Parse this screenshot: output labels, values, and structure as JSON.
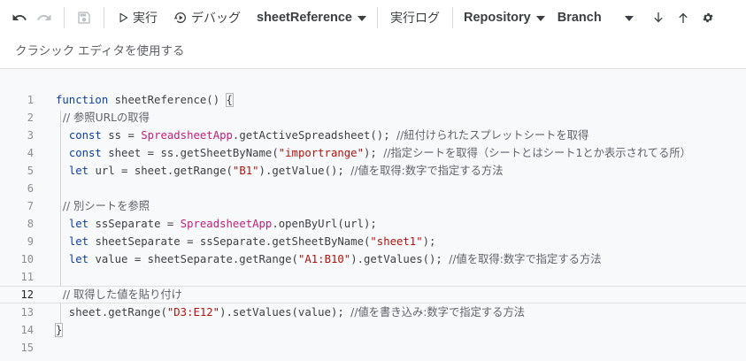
{
  "toolbar": {
    "run_label": "実行",
    "debug_label": "デバッグ",
    "function_select": "sheetReference",
    "log_label": "実行ログ",
    "repository_select": "Repository",
    "branch_select": "Branch"
  },
  "hint": "クラシック エディタを使用する",
  "editor": {
    "active_line": 12,
    "line_numbers": [
      "1",
      "2",
      "3",
      "4",
      "5",
      "6",
      "7",
      "8",
      "9",
      "10",
      "11",
      "12",
      "13",
      "14",
      "15"
    ],
    "lines": [
      [
        {
          "t": "function ",
          "c": "kw"
        },
        {
          "t": "sheetReference() ",
          "c": ""
        },
        {
          "t": "{",
          "c": "brace"
        }
      ],
      [
        {
          "t": "  // 参照URLの取得",
          "c": "cmt"
        }
      ],
      [
        {
          "t": "  ",
          "c": ""
        },
        {
          "t": "const ",
          "c": "kw"
        },
        {
          "t": "ss = ",
          "c": ""
        },
        {
          "t": "SpreadsheetApp",
          "c": "cls"
        },
        {
          "t": ".getActiveSpreadsheet(); ",
          "c": ""
        },
        {
          "t": "//紐付けられたスプレットシートを取得",
          "c": "cmt"
        }
      ],
      [
        {
          "t": "  ",
          "c": ""
        },
        {
          "t": "const ",
          "c": "kw"
        },
        {
          "t": "sheet = ss.getSheetByName(",
          "c": ""
        },
        {
          "t": "\"importrange\"",
          "c": "str"
        },
        {
          "t": "); ",
          "c": ""
        },
        {
          "t": "//指定シートを取得（シートとはシート1とか表示されてる所）",
          "c": "cmt"
        }
      ],
      [
        {
          "t": "  ",
          "c": ""
        },
        {
          "t": "let ",
          "c": "kw"
        },
        {
          "t": "url = sheet.getRange(",
          "c": ""
        },
        {
          "t": "\"B1\"",
          "c": "str"
        },
        {
          "t": ").getValue(); ",
          "c": ""
        },
        {
          "t": "//値を取得:数字で指定する方法",
          "c": "cmt"
        }
      ],
      [],
      [
        {
          "t": "  // 別シートを参照",
          "c": "cmt"
        }
      ],
      [
        {
          "t": "  ",
          "c": ""
        },
        {
          "t": "let ",
          "c": "kw"
        },
        {
          "t": "ssSeparate = ",
          "c": ""
        },
        {
          "t": "SpreadsheetApp",
          "c": "cls"
        },
        {
          "t": ".openByUrl(url);",
          "c": ""
        }
      ],
      [
        {
          "t": "  ",
          "c": ""
        },
        {
          "t": "let ",
          "c": "kw"
        },
        {
          "t": "sheetSeparate = ssSeparate.getSheetByName(",
          "c": ""
        },
        {
          "t": "\"sheet1\"",
          "c": "str"
        },
        {
          "t": ");",
          "c": ""
        }
      ],
      [
        {
          "t": "  ",
          "c": ""
        },
        {
          "t": "let ",
          "c": "kw"
        },
        {
          "t": "value = sheetSeparate.getRange(",
          "c": ""
        },
        {
          "t": "\"A1:B10\"",
          "c": "str"
        },
        {
          "t": ").getValues(); ",
          "c": ""
        },
        {
          "t": "//値を取得:数字で指定する方法",
          "c": "cmt"
        }
      ],
      [],
      [
        {
          "t": "  // 取得した値を貼り付け",
          "c": "cmt"
        }
      ],
      [
        {
          "t": "  sheet.getRange(",
          "c": ""
        },
        {
          "t": "\"D3:E12\"",
          "c": "str"
        },
        {
          "t": ").setValues(value); ",
          "c": ""
        },
        {
          "t": "//値を書き込み:数字で指定する方法",
          "c": "cmt"
        }
      ],
      [
        {
          "t": "}",
          "c": "brace"
        }
      ],
      []
    ]
  }
}
